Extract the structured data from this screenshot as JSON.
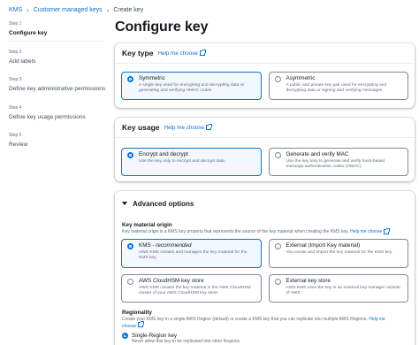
{
  "breadcrumb": {
    "items": [
      "KMS",
      "Customer managed keys",
      "Create key"
    ]
  },
  "steps": [
    {
      "num": "Step 1",
      "title": "Configure key"
    },
    {
      "num": "Step 2",
      "title": "Add labels"
    },
    {
      "num": "Step 3",
      "title": "Define key administrative permissions"
    },
    {
      "num": "Step 4",
      "title": "Define key usage permissions"
    },
    {
      "num": "Step 5",
      "title": "Review"
    }
  ],
  "page_title": "Configure key",
  "key_type": {
    "title": "Key type",
    "help": "Help me choose",
    "options": [
      {
        "label": "Symmetric",
        "desc": "A single key used for encrypting and decrypting data or generating and verifying HMAC codes",
        "selected": true
      },
      {
        "label": "Asymmetric",
        "desc": "A public and private key pair used for encrypting and decrypting data or signing and verifying messages",
        "selected": false
      }
    ]
  },
  "key_usage": {
    "title": "Key usage",
    "help": "Help me choose",
    "options": [
      {
        "label": "Encrypt and decrypt",
        "desc": "Use the key only to encrypt and decrypt data.",
        "selected": true
      },
      {
        "label": "Generate and verify MAC",
        "desc": "Use the key only to generate and verify hash-based message authentication codes (HMAC).",
        "selected": false
      }
    ]
  },
  "advanced": {
    "title": "Advanced options",
    "origin_label": "Key material origin",
    "origin_desc": "Key material origin is a KMS key property that represents the source of the key material when creating the KMS key.",
    "origin_help": "Help me choose",
    "origins": [
      {
        "label": "KMS",
        "suffix": " - recommended",
        "desc": "AWS KMS creates and manages the key material for the KMS key.",
        "selected": true
      },
      {
        "label": "External (Import Key material)",
        "suffix": "",
        "desc": "You create and import the key material for the KMS key.",
        "selected": false
      },
      {
        "label": "AWS CloudHSM key store",
        "suffix": "",
        "desc": "AWS KMS creates the key material in the AWS CloudHSM cluster of your AWS CloudHSM key store.",
        "selected": false
      },
      {
        "label": "External key store",
        "suffix": "",
        "desc": "AWS KMS uses the key in an external key manager outside of AWS.",
        "selected": false
      }
    ],
    "regionality_label": "Regionality",
    "regionality_desc": "Create your KMS key in a single AWS Region (default) or create a KMS key that you can replicate into multiple AWS Regions.",
    "regionality_help_a": "Help me",
    "regionality_help_b": "choose",
    "single_region_label": "Single-Region key",
    "single_region_desc": "Never allow this key to be replicated into other Regions"
  },
  "colors": {
    "link": "#0972d3",
    "selected_bg": "#f2f8fd"
  }
}
